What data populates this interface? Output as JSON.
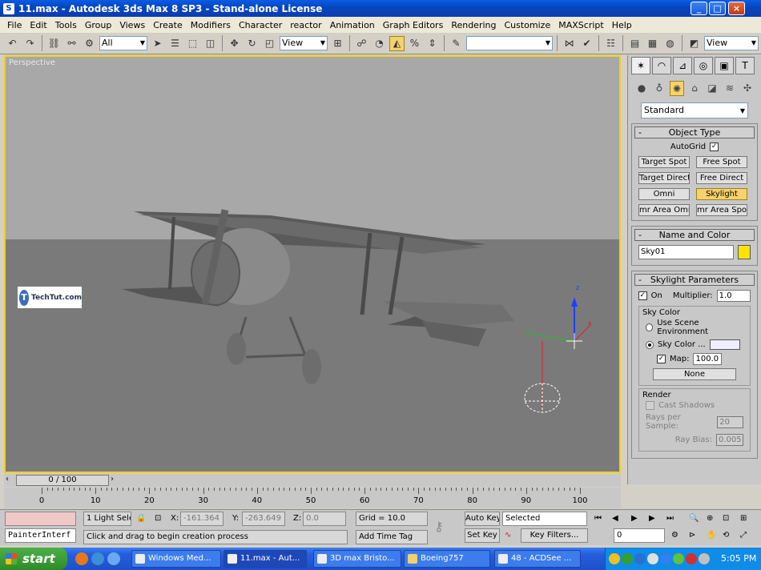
{
  "window": {
    "title": "11.max - Autodesk 3ds Max 8 SP3 - Stand-alone License",
    "min": "_",
    "max": "□",
    "close": "×"
  },
  "menu": [
    "File",
    "Edit",
    "Tools",
    "Group",
    "Views",
    "Create",
    "Modifiers",
    "Character",
    "reactor",
    "Animation",
    "Graph Editors",
    "Rendering",
    "Customize",
    "MAXScript",
    "Help"
  ],
  "toolbar": {
    "filter_value": "All",
    "ref_coord_value": "View",
    "named_sel_value": "",
    "view_right_value": "View"
  },
  "viewport": {
    "label": "Perspective",
    "logo_text": "TechTut.com",
    "logo_letter": "T",
    "axis_x": "x",
    "axis_y": "y",
    "axis_z": "z"
  },
  "command_panel": {
    "category_value": "Standard",
    "object_type": {
      "header": "Object Type",
      "autogrid_label": "AutoGrid",
      "autogrid_checked": "✓",
      "buttons": [
        "Target Spot",
        "Free Spot",
        "Target Direct",
        "Free Direct",
        "Omni",
        "Skylight",
        "mr Area Omni",
        "mr Area Spot"
      ],
      "active_button": "Skylight"
    },
    "name_color": {
      "header": "Name and Color",
      "name_value": "Sky01",
      "color": "#ffe400"
    },
    "skylight_params": {
      "header": "Skylight Parameters",
      "on_label": "On",
      "on_checked": "✓",
      "multiplier_label": "Multiplier:",
      "multiplier_value": "1.0",
      "sky_color_title": "Sky Color",
      "use_scene_env_label": "Use Scene Environment",
      "sky_color_label": "Sky Color ...",
      "sky_color_swatch": "#eeeeff",
      "map_label": "Map:",
      "map_checked": "✓",
      "map_value": "100.0",
      "map_button": "None",
      "render_title": "Render",
      "cast_shadows_label": "Cast Shadows",
      "rays_label": "Rays per Sample:",
      "rays_value": "20",
      "raybias_label": "Ray Bias:",
      "raybias_value": "0.005"
    },
    "rollout_minus": "-"
  },
  "timeline": {
    "frame_display": "0 / 100",
    "ticks": [
      "0",
      "10",
      "20",
      "30",
      "40",
      "50",
      "60",
      "70",
      "80",
      "90",
      "100"
    ]
  },
  "status": {
    "maxscript_listener": "PainterInterf",
    "selection_count": "1 Light Sele",
    "x_label": "X:",
    "x_value": "-161.364",
    "y_label": "Y:",
    "y_value": "-263.649",
    "z_label": "Z:",
    "z_value": "0.0",
    "grid": "Grid = 10.0",
    "prompt": "Click and drag to begin creation process",
    "add_time_tag": "Add Time Tag",
    "auto_key": "Auto Key",
    "set_key": "Set Key",
    "selected_value": "Selected",
    "key_filters": "Key Filters...",
    "current_frame": "0"
  },
  "taskbar": {
    "start": "start",
    "tasks": [
      "Windows Med...",
      "11.max - Aut...",
      "3D max Bristo...",
      "Boeing757",
      "48 - ACDSee ..."
    ],
    "active_task": "11.max - Aut...",
    "clock": "5:05 PM"
  }
}
